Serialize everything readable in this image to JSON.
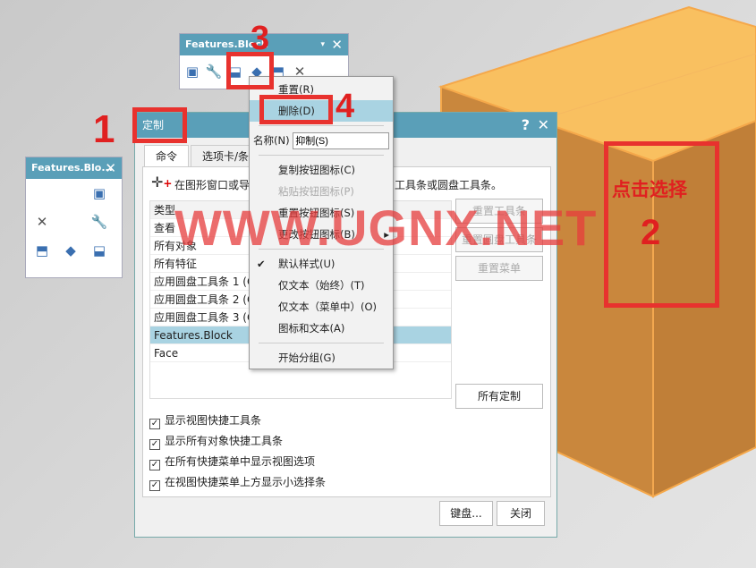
{
  "toolbar_block": {
    "title": "Features.Block"
  },
  "toolbar_left": {
    "title": "Features.Blo..."
  },
  "dialog": {
    "title": "定制",
    "help": "?",
    "close": "✕",
    "tabs": [
      "命令",
      "选项卡/条"
    ],
    "hint": "在图形窗口或导",
    "hint_right": "工具条或圆盘工具条。",
    "list": [
      "类型",
      "查看",
      "所有对象",
      "所有特征",
      "应用圆盘工具条 1 (C",
      "应用圆盘工具条 2 (C",
      "应用圆盘工具条 3 (C",
      "Features.Block",
      "Face"
    ],
    "selected": "Features.Block",
    "buttons": {
      "reset_toolbar": "重置工具条",
      "reset_radial": "重置圆盘工具条",
      "reset_menu": "重置菜单",
      "all_custom": "所有定制",
      "keyboard": "键盘...",
      "close": "关闭"
    },
    "checkboxes": [
      {
        "label": "显示视图快捷工具条",
        "checked": true
      },
      {
        "label": "显示所有对象快捷工具条",
        "checked": true
      },
      {
        "label": "在所有快捷菜单中显示视图选项",
        "checked": true
      },
      {
        "label": "在视图快捷菜单上方显示小选择条",
        "checked": true
      }
    ]
  },
  "menu": {
    "reset": "重置(R)",
    "delete": "删除(D)",
    "name_label": "名称(N)",
    "name_value": "抑制(S)",
    "copy_icon": "复制按钮图标(C)",
    "paste_icon": "粘贴按钮图标(P)",
    "reset_icon": "重置按钮图标(S)",
    "change_icon": "更改按钮图标(B)",
    "default_style": "默认样式(U)",
    "text_only_always": "仅文本（始终）(T)",
    "text_only_menu": "仅文本（菜单中）(O)",
    "icon_text": "图标和文本(A)",
    "begin_group": "开始分组(G)"
  },
  "annotations": {
    "n1": "1",
    "n2": "2",
    "n3": "3",
    "n4": "4",
    "click_select": "点击选择",
    "watermark": "WWW.UGNX.NET"
  },
  "colors": {
    "title_bar": "#5a9fb8",
    "highlight": "#a9d3e2",
    "box_top": "#f9c060",
    "box_front": "#c9873d",
    "annotation": "#e8322e"
  }
}
